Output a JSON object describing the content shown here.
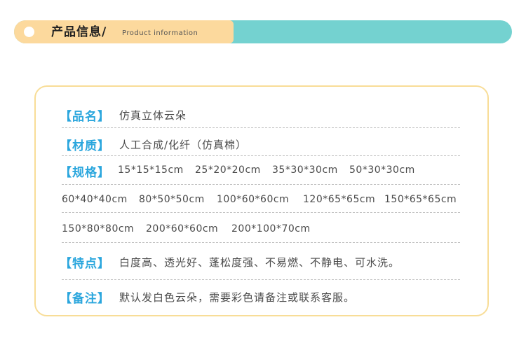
{
  "header": {
    "title": "产品信息/",
    "subtitle": "Product information"
  },
  "info": {
    "name": {
      "label": "【品名】",
      "value": "仿真立体云朵"
    },
    "material": {
      "label": "【材质】",
      "value": "人工合成/化纤（仿真棉）"
    },
    "spec": {
      "label": "【规格】",
      "sizes": [
        "15*15*15cm",
        "25*20*20cm",
        "35*30*30cm",
        "50*30*30cm",
        "60*40*40cm",
        "80*50*50cm",
        "100*60*60cm",
        "120*65*65cm",
        "150*65*65cm",
        "150*80*80cm",
        "200*60*60cm",
        "200*100*70cm"
      ]
    },
    "features": {
      "label": "【特点】",
      "value": "白度高、透光好、蓬松度强、不易燃、不静电、可水洗。"
    },
    "note": {
      "label": "【备注】",
      "value": "默认发白色云朵，需要彩色请备注或联系客服。"
    }
  },
  "colors": {
    "bar_teal": "#74d2d0",
    "bar_yellow": "#fcd99d",
    "card_border": "#f8dd97",
    "label_blue": "#2aa6dd",
    "text_gray": "#4a4a4a"
  }
}
